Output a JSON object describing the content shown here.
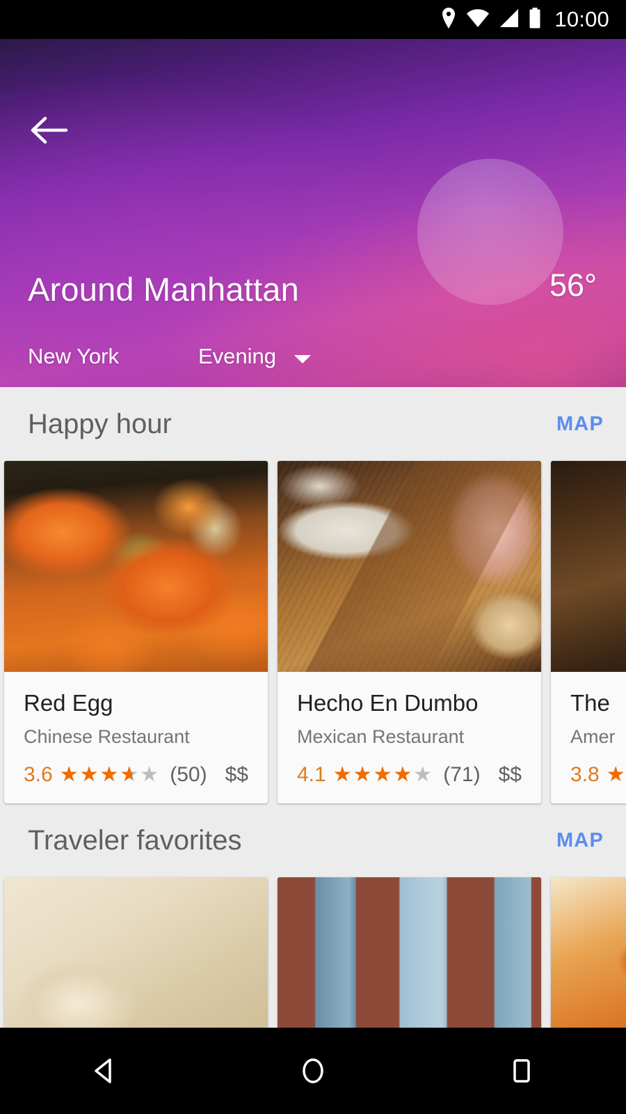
{
  "status_bar": {
    "time": "10:00",
    "icons": [
      "location-pin-icon",
      "wifi-icon",
      "cellular-signal-icon",
      "battery-icon"
    ]
  },
  "header": {
    "back_icon": "back-arrow-icon",
    "sun_icon": "sun-circle",
    "title": "Around Manhattan",
    "city": "New York",
    "time_of_day": "Evening",
    "time_of_day_caret": "chevron-down-icon",
    "temperature": "56°"
  },
  "sections": [
    {
      "title": "Happy hour",
      "map_label": "MAP",
      "cards": [
        {
          "name": "Red Egg",
          "category": "Chinese Restaurant",
          "rating": "3.6",
          "rating_value": 3.6,
          "stars_filled": "★★★★★",
          "stars_empty": "★★★★★",
          "review_count": "(50)",
          "price": "$$",
          "photo": "ph-redegg"
        },
        {
          "name": "Hecho En Dumbo",
          "category": "Mexican Restaurant",
          "rating": "4.1",
          "rating_value": 4.1,
          "stars_filled": "★★★★★",
          "stars_empty": "★★★★★",
          "review_count": "(71)",
          "price": "$$",
          "photo": "ph-hecho"
        },
        {
          "name": "The",
          "category": "Amer",
          "rating": "3.8",
          "rating_value": 3.8,
          "stars_filled": "★★★★★",
          "stars_empty": "★★★★★",
          "review_count": "",
          "price": "",
          "photo": "ph-third"
        }
      ]
    },
    {
      "title": "Traveler favorites",
      "map_label": "MAP",
      "cards": [
        {
          "photo": "ph-white"
        },
        {
          "photo": "ph-brick"
        },
        {
          "photo": "ph-orange2"
        }
      ]
    }
  ],
  "nav_bar": {
    "back": "nav-back-icon",
    "home": "nav-home-icon",
    "recents": "nav-recents-icon"
  },
  "colors": {
    "accent_blue": "#5b8def",
    "rating_orange": "#ef6c00",
    "star_empty": "#bdbdbd",
    "header_purple": "#7a2aa8",
    "header_magenta": "#c44bae",
    "background": "#ececec"
  }
}
